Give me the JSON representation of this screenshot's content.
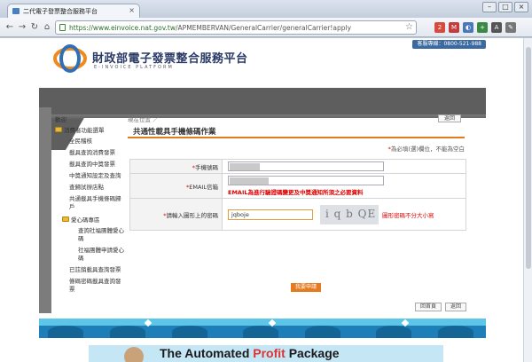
{
  "browser": {
    "tab_title": "二代電子發票整合服務平台",
    "tab_close": "×",
    "window_buttons": [
      "–",
      "□",
      "×"
    ],
    "url_host": "https://www.einvoice.nat.gov.tw",
    "url_path": "/APMEMBERVAN/GeneralCarrier/generalCarrier!apply",
    "nav": {
      "back": "←",
      "forward": "→",
      "reload": "↻",
      "home": "⌂"
    },
    "star": "☆",
    "extensions": [
      {
        "label": "2",
        "color": "#d94a3d"
      },
      {
        "label": "M",
        "color": "#c33c3c"
      },
      {
        "label": "◐",
        "color": "#4a78b8"
      },
      {
        "label": "+",
        "color": "#3a8a46"
      },
      {
        "label": "A",
        "color": "#555555"
      },
      {
        "label": "✎",
        "color": "#777777"
      }
    ]
  },
  "header": {
    "title": "財政部電子發票整合服務平台",
    "subtitle": "E-INVOICE PLATFORM",
    "hotline": "客服專線：0800-521-988"
  },
  "sidebar": {
    "home": "歡迎",
    "consumer_section": "消費者功能選單",
    "consumer_items": [
      "全民稽核",
      "載具查詢消費發票",
      "載具查詢中獎發票",
      "中獎通知設定及查詢",
      "查歸試辦店點",
      "共通載具手機條碼歸戶"
    ],
    "donation_section": "愛心碼專區",
    "donation_items": [
      "查詢社福團體愛心碼",
      "社福團體申請愛心碼"
    ],
    "other_items": [
      "已註銷載具查詢發票",
      "條碼密碼載具查詢發票"
    ]
  },
  "main": {
    "breadcrumb": "現在位置 ／",
    "back_label": "返回",
    "title": "共通性載具手機條碼作業",
    "required_note_star": "*",
    "required_note": "為必填(選)欄位，不能為空白",
    "phone_label": "手機號碼",
    "email_label": "EMAIL信箱",
    "email_warning": "EMAIL為進行驗證碼變更及中獎通知所須之必要資料",
    "captcha_label": "請輸入圖形上的密碼",
    "captcha_value": "jqboje",
    "captcha_image_text": "i q b QE",
    "captcha_tip": "圖形密碼不分大小寫",
    "submit_label": "我要申請",
    "home_button": "回首頁",
    "return_button": "返回"
  },
  "ad": {
    "text_before": "The Automated ",
    "text_profit": "Profit",
    "text_after": " Package"
  }
}
